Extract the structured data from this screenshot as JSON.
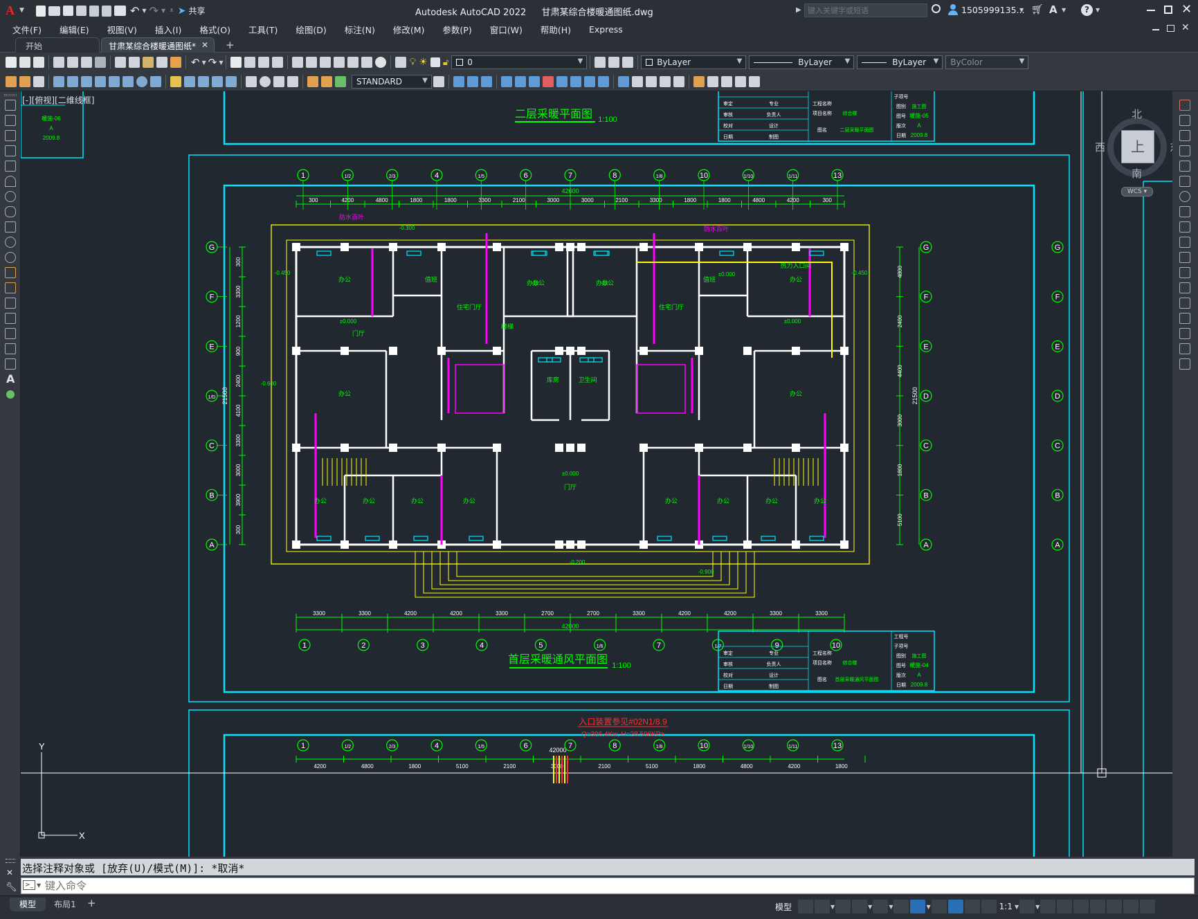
{
  "titlebar": {
    "share_label": "共享",
    "app_title": "Autodesk AutoCAD 2022",
    "file_name": "甘肃某综合楼暖通图纸.dwg",
    "search_placeholder": "键入关键字或短语",
    "user_name": "1505999135...",
    "help_icon": "question-icon"
  },
  "menu": [
    "文件(F)",
    "编辑(E)",
    "视图(V)",
    "插入(I)",
    "格式(O)",
    "工具(T)",
    "绘图(D)",
    "标注(N)",
    "修改(M)",
    "参数(P)",
    "窗口(W)",
    "帮助(H)",
    "Express"
  ],
  "tabs": {
    "start": "开始",
    "drawing": "甘肃某综合楼暖通图纸*",
    "add": "+"
  },
  "toolbar": {
    "layer_value": "0",
    "color_value": "ByLayer",
    "linetype_value": "ByLayer",
    "lineweight_value": "ByLayer",
    "plotstyle_value": "ByColor",
    "textstyle_value": "STANDARD"
  },
  "viewport": {
    "label": "[-][俯视][二维线框]"
  },
  "viewcube": {
    "north": "北",
    "south": "南",
    "east": "东",
    "west": "西",
    "face": "上",
    "wcs": "WCS"
  },
  "ucs": {
    "x": "X",
    "y": "Y"
  },
  "drawing": {
    "title_second": "二层采暖平面图",
    "title_first": "首层采暖通风平面图",
    "scale": "1:100",
    "total_dim_top": "42600",
    "total_dim_bottom": "42000",
    "total_dim_third": "42000",
    "total_height": "21500",
    "dims_top": [
      "300",
      "4200",
      "4800",
      "1800",
      "1800",
      "3300",
      "2100",
      "3000",
      "3000",
      "2100",
      "3300",
      "1800",
      "1800",
      "4800",
      "4200",
      "300"
    ],
    "dims_bottom": [
      "3300",
      "3300",
      "4200",
      "4200",
      "3300",
      "2700",
      "2700",
      "3300",
      "4200",
      "4200",
      "3300",
      "3300"
    ],
    "dims_third": [
      "4200",
      "4800",
      "1800",
      "5100",
      "2100",
      "3000",
      "2100",
      "5100",
      "1800",
      "4800",
      "4200",
      "1800"
    ],
    "dims_left": [
      "300",
      "3300",
      "1200",
      "900",
      "2400",
      "4100",
      "3300",
      "3000",
      "3900",
      "300"
    ],
    "dims_right": [
      "4800",
      "2400",
      "4400",
      "3000",
      "1800",
      "5100"
    ],
    "grid_top": [
      "1",
      "1/2",
      "2/3",
      "4",
      "1/5",
      "6",
      "7",
      "8",
      "1/8",
      "10",
      "1/10",
      "1/11",
      "13"
    ],
    "grid_bottom": [
      "1",
      "2",
      "3",
      "4",
      "5",
      "1/6",
      "7",
      "1/7",
      "9",
      "10"
    ],
    "grid_rows": [
      "G",
      "F",
      "E",
      "1/D",
      "C",
      "B",
      "A"
    ],
    "grid_rows_right": [
      "G",
      "F",
      "E",
      "D",
      "C",
      "B",
      "A"
    ],
    "rooms": {
      "office": "办公",
      "lobby": "门厅",
      "residential_lobby": "住宅门厅",
      "stair": "楼梯",
      "duty": "值班",
      "heat_room": "热力入口间",
      "hall": "门厅",
      "toilet": "卫生间",
      "storage": "库房"
    },
    "levels": {
      "zero": "±0.000",
      "m300": "-0.300",
      "m450": "-0.450",
      "m600": "-0.600",
      "m900": "-0.900",
      "m200": "-0.200"
    },
    "labels": {
      "louver": "防水百叶",
      "entry_note": "入口装置参见#02N1/8.9",
      "entry_spec": "Q=306.4Kw, H=28.506KPa"
    },
    "title_block": {
      "project": "工程名称",
      "item": "项目名称",
      "drawing": "图名",
      "sheet_top": "暖施-05",
      "sheet_bottom": "暖施-04",
      "grade": "A",
      "date": "2009.8",
      "sheet_left": "暖施-06",
      "name_top": "二层采暖平面图",
      "name_bottom": "首层采暖通风平面图",
      "building": "综合楼",
      "construction": "施工图",
      "rows": [
        "专业",
        "负责人",
        "设计",
        "制图"
      ],
      "rows_left": [
        "审定",
        "审核",
        "校对",
        "日期"
      ],
      "right": [
        "工程号",
        "子项号",
        "图别",
        "图号",
        "版次",
        "日期"
      ]
    }
  },
  "command": {
    "history": "选择注释对象或 [放弃(U)/模式(M)]: *取消*",
    "placeholder": "键入命令"
  },
  "status": {
    "model_tab": "模型",
    "layout_tab": "布局1",
    "model_button": "模型",
    "scale": "1:1"
  },
  "colors": {
    "canvas": "#212830",
    "frame": "#00e5ff",
    "wall": "#ffffff",
    "dimension": "#00ff00",
    "pipe": "#ff00ff",
    "outline": "#ffff00",
    "accent": "#e8242c"
  }
}
